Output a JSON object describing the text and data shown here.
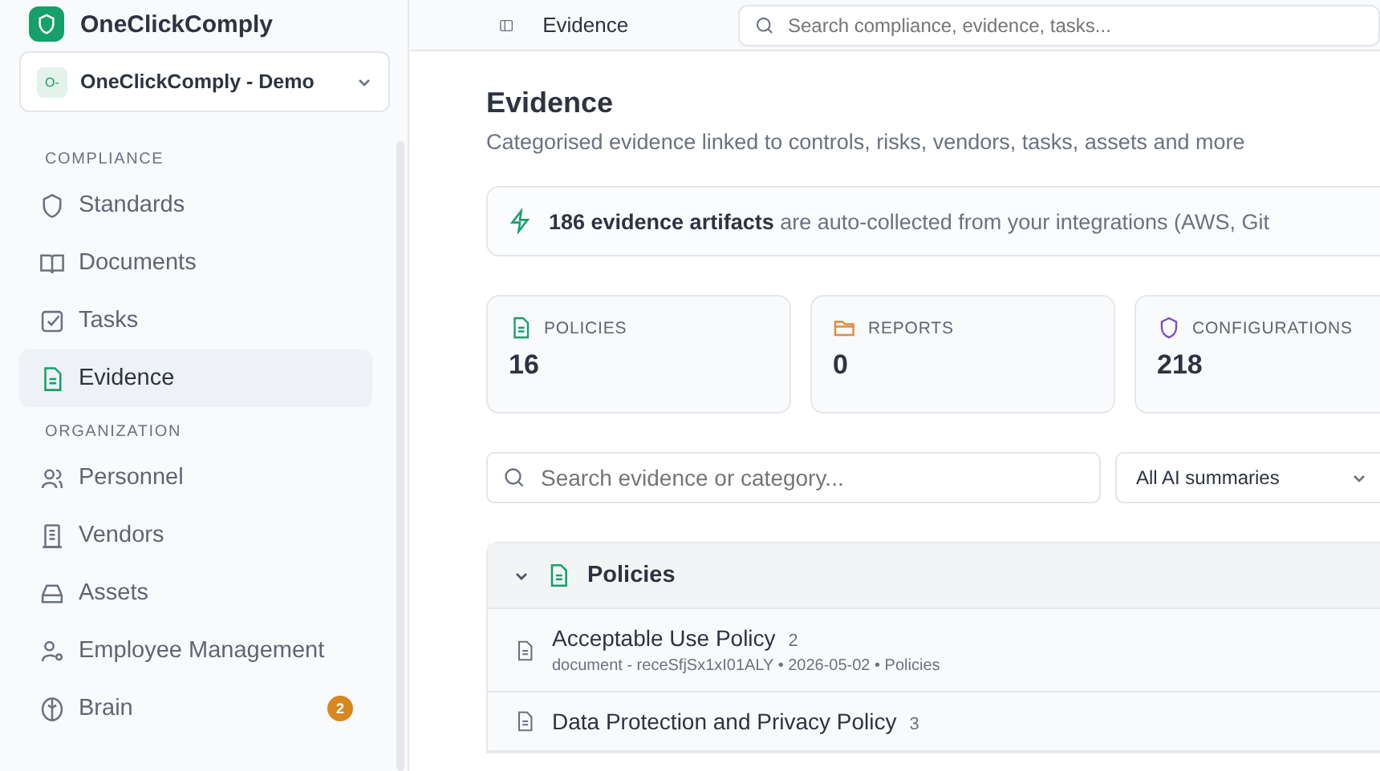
{
  "sidebar": {
    "brand": "OneClickComply",
    "workspace": "OneClickComply - Demo",
    "workspace_badge": "O-",
    "sections": [
      {
        "heading": "COMPLIANCE",
        "items": [
          {
            "label": "Standards",
            "selected": false
          },
          {
            "label": "Documents",
            "selected": false
          },
          {
            "label": "Tasks",
            "selected": false
          },
          {
            "label": "Evidence",
            "selected": true
          }
        ]
      },
      {
        "heading": "ORGANIZATION",
        "items": [
          {
            "label": "Personnel",
            "selected": false
          },
          {
            "label": "Vendors",
            "selected": false
          },
          {
            "label": "Assets",
            "selected": false
          },
          {
            "label": "Employee Management",
            "selected": false
          },
          {
            "label": "Brain",
            "selected": false,
            "badge": "2"
          }
        ]
      }
    ]
  },
  "topbar": {
    "breadcrumb": "Evidence",
    "search": {
      "placeholder": "Search compliance, evidence, tasks..."
    }
  },
  "page": {
    "title": "Evidence",
    "subtitle": "Categorised evidence linked to controls, risks, vendors, tasks, assets and more",
    "banner": "**186 evidence artifacts** are auto-collected from your integrations (AWS, Git",
    "stats": [
      {
        "label": "POLICIES",
        "value": "16",
        "color": "#16a06a"
      },
      {
        "label": "REPORTS",
        "value": "0",
        "color": "#e08a3c"
      },
      {
        "label": "CONFIGURATIONS",
        "value": "218",
        "color": "#7c4dc4"
      }
    ],
    "search": {
      "placeholder": "Search evidence or category..."
    },
    "filter": "All AI summaries",
    "groups": [
      {
        "title": "Policies",
        "expanded": true,
        "rows": [
          {
            "title": "Acceptable Use Policy",
            "count": "2",
            "meta": "document - receSfjSx1xI01ALY • 2026-05-02 • Policies"
          },
          {
            "title": "Data Protection and Privacy Policy",
            "count": "3"
          }
        ]
      }
    ]
  }
}
